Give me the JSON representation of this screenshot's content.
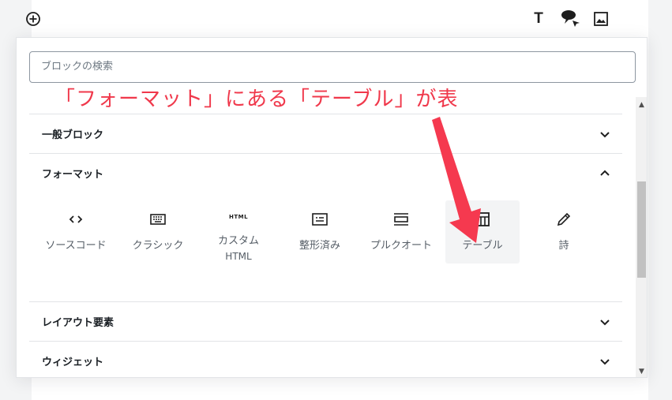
{
  "toolbar": {
    "add_icon": "plus-circle-icon",
    "heading_icon": "T",
    "speech_icon": "speech-bubble-icon",
    "image_icon": "image-icon"
  },
  "inserter": {
    "search_placeholder": "ブロックの検索",
    "annotation": "「フォーマット」にある「テーブル」が表",
    "sections": [
      {
        "label": "一般ブロック",
        "expanded": false
      },
      {
        "label": "フォーマット",
        "expanded": true
      },
      {
        "label": "レイアウト要素",
        "expanded": false
      },
      {
        "label": "ウィジェット",
        "expanded": false
      }
    ],
    "format_blocks": [
      {
        "label": "ソースコード",
        "label2": "",
        "icon": "code-icon"
      },
      {
        "label": "クラシック",
        "label2": "",
        "icon": "keyboard-icon"
      },
      {
        "label": "カスタム",
        "label2": "HTML",
        "icon": "html-icon",
        "icon_text": "HTML"
      },
      {
        "label": "整形済み",
        "label2": "",
        "icon": "preformatted-icon"
      },
      {
        "label": "プルクオート",
        "label2": "",
        "icon": "pullquote-icon"
      },
      {
        "label": "テーブル",
        "label2": "",
        "icon": "table-icon",
        "selected": true
      },
      {
        "label": "詩",
        "label2": "",
        "icon": "pencil-icon"
      }
    ]
  },
  "colors": {
    "annotation": "#f0384b",
    "arrow": "#f5394f",
    "selected_bg": "#f3f4f5"
  }
}
